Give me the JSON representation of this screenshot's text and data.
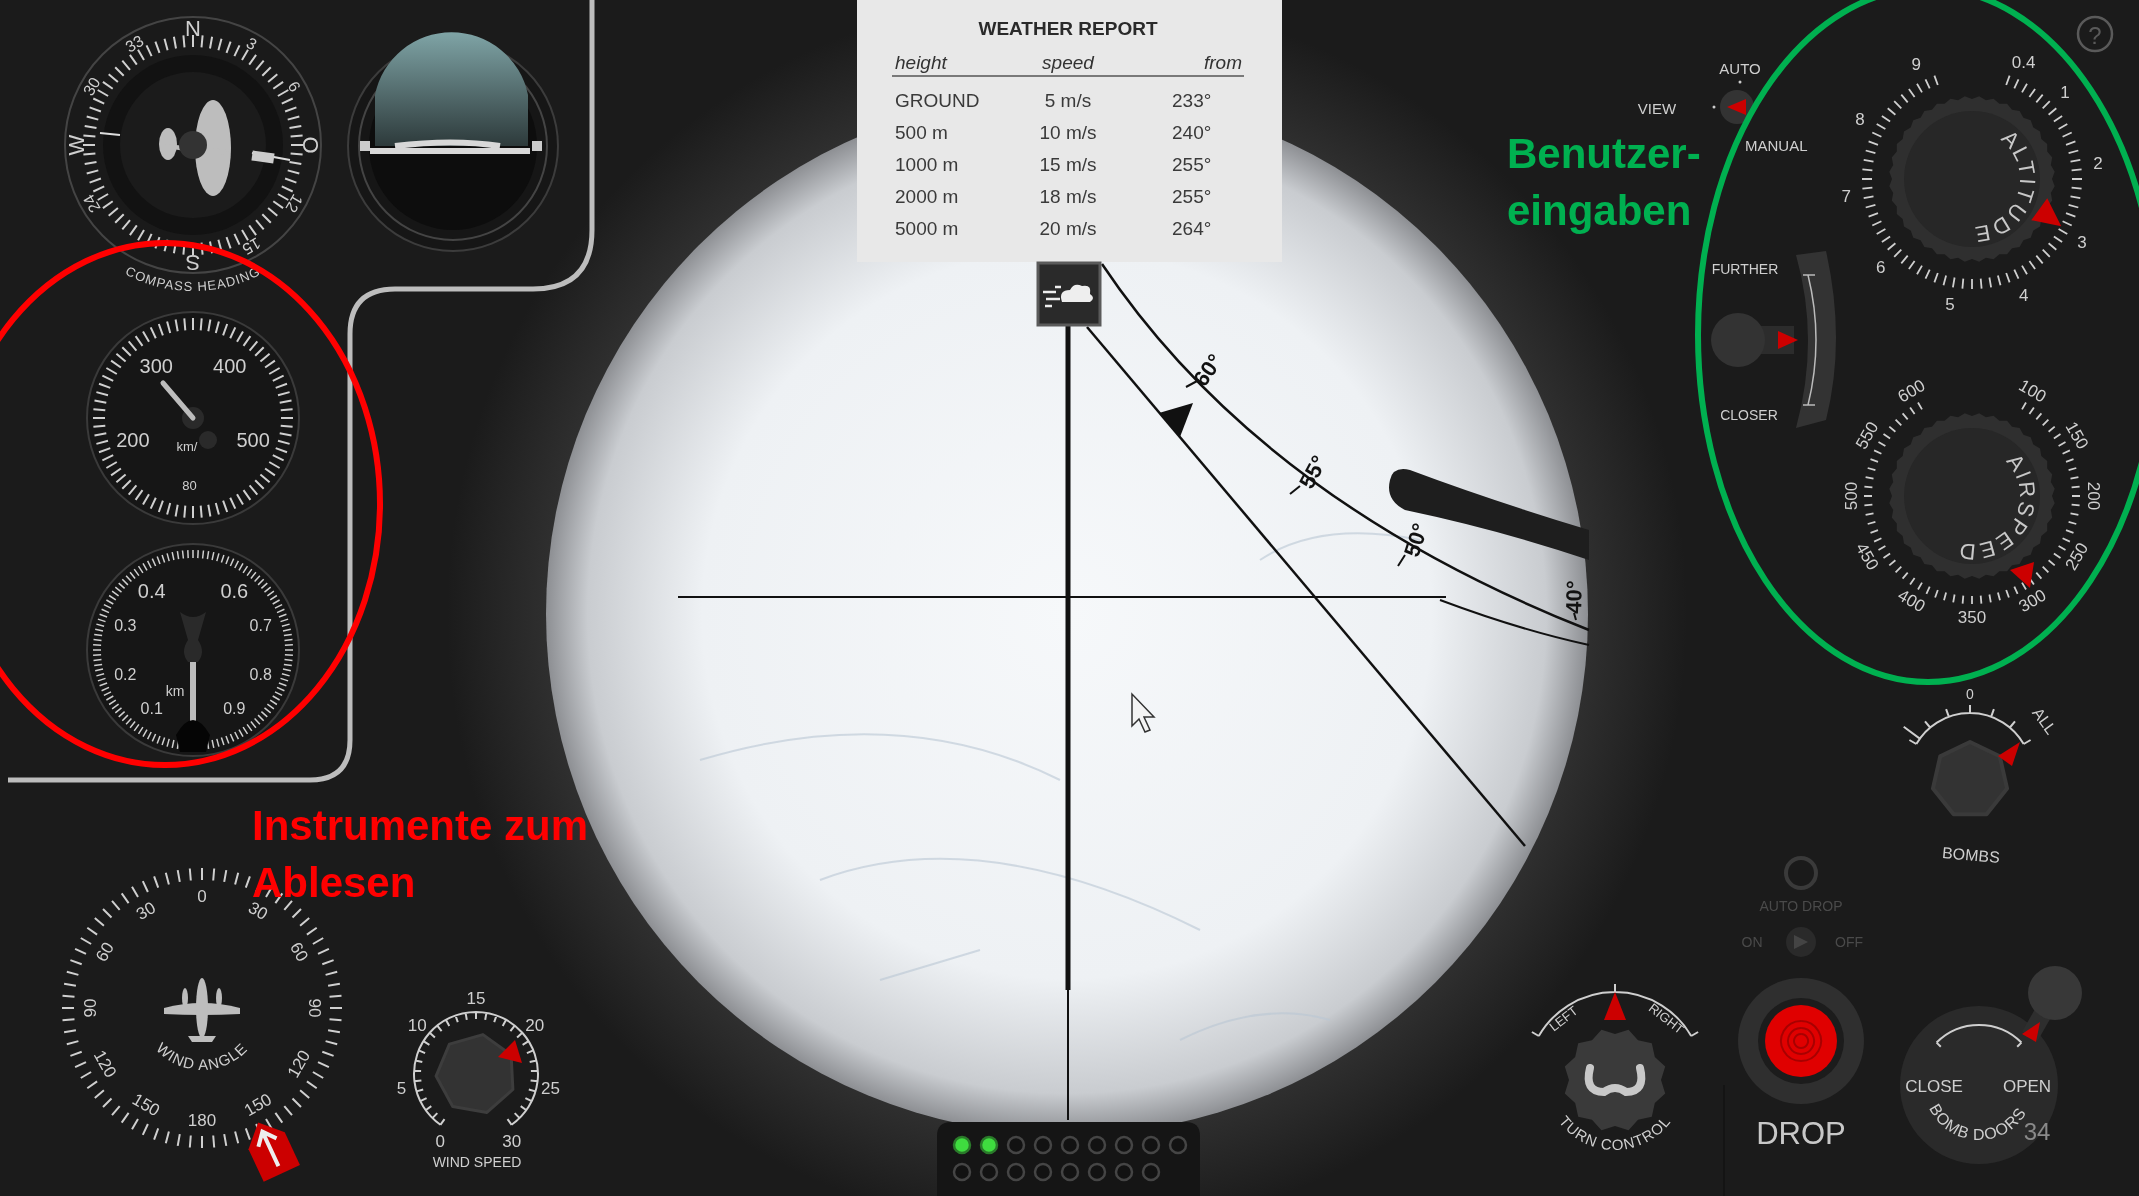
{
  "compass": {
    "labels": [
      "N",
      "3",
      "6",
      "O",
      "12",
      "15",
      "S",
      "24",
      "W",
      "30",
      "33"
    ],
    "caption": "COMPASS HEADING"
  },
  "airspeed_gauge": {
    "labels": [
      "200",
      "300",
      "400",
      "500"
    ],
    "unit": "km/",
    "sub_label": "80"
  },
  "altimeter": {
    "labels": [
      "0.1",
      "0.2",
      "0.3",
      "0.4",
      "0.6",
      "0.7",
      "0.8",
      "0.9"
    ],
    "unit": "km"
  },
  "wind_angle": {
    "labels": [
      "0",
      "30",
      "60",
      "90",
      "120",
      "150",
      "180",
      "150",
      "120",
      "90",
      "60",
      "30"
    ],
    "caption": "WIND ANGLE"
  },
  "wind_speed": {
    "labels": [
      "0",
      "5",
      "10",
      "15",
      "20",
      "25",
      "30"
    ],
    "caption": "WIND SPEED"
  },
  "weather_report": {
    "title": "WEATHER REPORT",
    "columns": [
      "height",
      "speed",
      "from"
    ],
    "rows": [
      [
        "GROUND",
        "5 m/s",
        "233°"
      ],
      [
        "500 m",
        "10 m/s",
        "240°"
      ],
      [
        "1000 m",
        "15 m/s",
        "255°"
      ],
      [
        "2000 m",
        "18 m/s",
        "255°"
      ],
      [
        "5000 m",
        "20 m/s",
        "264°"
      ]
    ]
  },
  "bombsight": {
    "angle_labels": [
      "60°",
      "55°",
      "50°",
      "40°"
    ]
  },
  "view_selector": {
    "label": "VIEW",
    "options": [
      "AUTO",
      "MANUAL"
    ]
  },
  "range_slider": {
    "top_label": "FURTHER",
    "bottom_label": "CLOSER",
    "level": 0.5
  },
  "help_button": {
    "label": "?"
  },
  "altitude_dial": {
    "caption": "ALTITUDE",
    "labels": [
      "0.4",
      "1",
      "2",
      "3",
      "4",
      "5",
      "6",
      "7",
      "8",
      "9"
    ]
  },
  "airspeed_dial": {
    "caption": "AIRSPEED",
    "labels": [
      "100",
      "150",
      "200",
      "250",
      "300",
      "350",
      "400",
      "450",
      "500",
      "550",
      "600"
    ]
  },
  "bombs_selector": {
    "caption": "BOMBS",
    "labels": [
      "0",
      "ALL"
    ]
  },
  "auto_drop": {
    "label": "AUTO DROP",
    "on_label": "ON",
    "off_label": "OFF",
    "on": false
  },
  "turn_control": {
    "caption": "TURN CONTROL",
    "left_label": "LEFT",
    "right_label": "RIGHT"
  },
  "drop_button": {
    "label": "DROP"
  },
  "bomb_doors": {
    "caption": "BOMB DOORS",
    "close_label": "CLOSE",
    "open_label": "OPEN",
    "overlay_text": "34"
  },
  "indicator_lights": [
    {
      "lit": true
    },
    {
      "lit": true
    },
    {
      "lit": false
    },
    {
      "lit": false
    },
    {
      "lit": false
    },
    {
      "lit": false
    },
    {
      "lit": false
    },
    {
      "lit": false
    },
    {
      "lit": false
    },
    {
      "lit": false
    },
    {
      "lit": false
    },
    {
      "lit": false
    },
    {
      "lit": false
    },
    {
      "lit": false
    },
    {
      "lit": false
    },
    {
      "lit": false
    },
    {
      "lit": false
    }
  ],
  "annotations": [
    {
      "lines": [
        "Instrumente zum",
        "Ablesen"
      ],
      "color": "#ff0000"
    },
    {
      "lines": [
        "Benutzer-",
        "eingaben"
      ],
      "color": "#00b050"
    }
  ]
}
